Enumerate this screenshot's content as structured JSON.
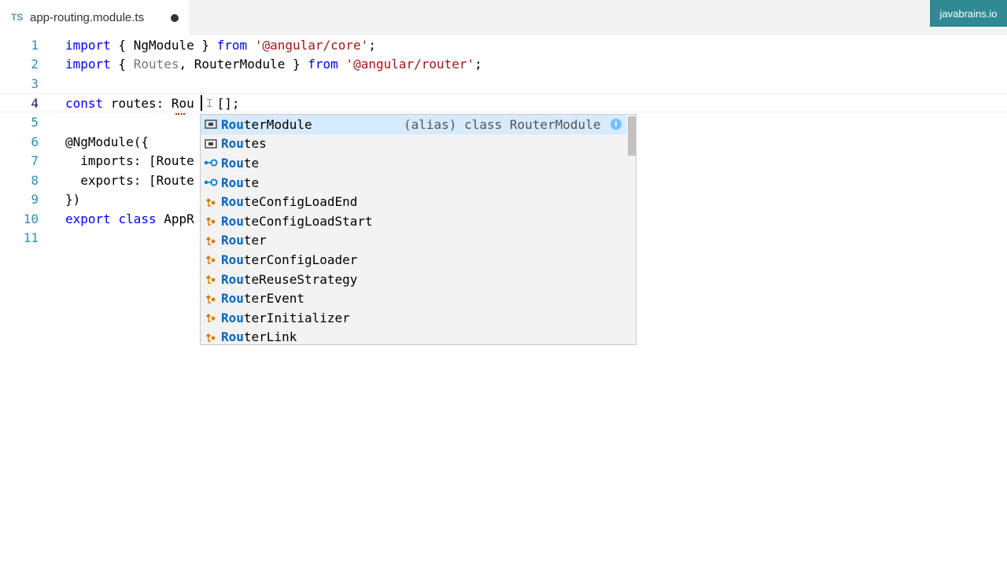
{
  "tab": {
    "icon_label": "TS",
    "title": "app-routing.module.ts"
  },
  "watermark": "javabrains.io",
  "lines": [
    {
      "n": "1"
    },
    {
      "n": "2"
    },
    {
      "n": "3"
    },
    {
      "n": "4"
    },
    {
      "n": "5"
    },
    {
      "n": "6"
    },
    {
      "n": "7"
    },
    {
      "n": "8"
    },
    {
      "n": "9"
    },
    {
      "n": "10"
    },
    {
      "n": "11"
    }
  ],
  "code": {
    "l1": {
      "k1": "import",
      "t1": " { NgModule } ",
      "k2": "from",
      "s": " '@angular/core'",
      "t2": ";"
    },
    "l2": {
      "k1": "import",
      "t1": " { ",
      "dim": "Routes",
      "t2": ", RouterModule } ",
      "k2": "from",
      "s": " '@angular/router'",
      "t3": ";"
    },
    "l4": {
      "k1": "const",
      "t1": " routes: Rou",
      "t2": "   [];"
    },
    "l6": "@NgModule({",
    "l7": "  imports: [Route",
    "l8": "  exports: [Route",
    "l9": "})",
    "l10": {
      "k1": "export",
      "t1": " ",
      "k2": "class",
      "t2": " AppR"
    }
  },
  "suggestions": [
    {
      "hl": "Rou",
      "rest": "terModule",
      "icon": "module-icon",
      "detail": "(alias) class RouterModule"
    },
    {
      "hl": "Rou",
      "rest": "tes",
      "icon": "module-icon"
    },
    {
      "hl": "Rou",
      "rest": "te",
      "icon": "interface-icon"
    },
    {
      "hl": "Rou",
      "rest": "te",
      "icon": "interface-icon"
    },
    {
      "hl": "Rou",
      "rest": "teConfigLoadEnd",
      "icon": "class-icon"
    },
    {
      "hl": "Rou",
      "rest": "teConfigLoadStart",
      "icon": "class-icon"
    },
    {
      "hl": "Rou",
      "rest": "ter",
      "icon": "class-icon"
    },
    {
      "hl": "Rou",
      "rest": "terConfigLoader",
      "icon": "class-icon"
    },
    {
      "hl": "Rou",
      "rest": "teReuseStrategy",
      "icon": "class-icon"
    },
    {
      "hl": "Rou",
      "rest": "terEvent",
      "icon": "class-icon"
    },
    {
      "hl": "Rou",
      "rest": "terInitializer",
      "icon": "class-icon"
    },
    {
      "hl": "Rou",
      "rest": "terLink",
      "icon": "class-icon"
    }
  ],
  "info_icon_glyph": "i",
  "colors": {
    "keyword": "#0000ff",
    "string": "#a31515",
    "line_number": "#2b91af",
    "selection": "#d6ebff",
    "class_icon": "#d67e00"
  }
}
